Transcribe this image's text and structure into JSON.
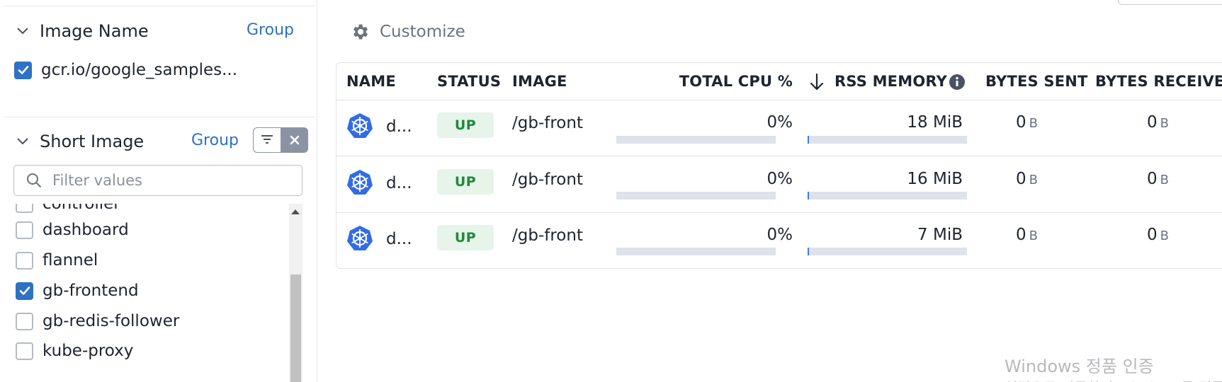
{
  "sidebar": {
    "facets": [
      {
        "title": "Image Name",
        "group_label": "Group",
        "selected": [
          {
            "label": "gcr.io/google_samples...",
            "checked": true
          }
        ]
      },
      {
        "title": "Short Image",
        "group_label": "Group",
        "search_placeholder": "Filter values",
        "values": [
          {
            "label": "controller",
            "checked": false
          },
          {
            "label": "dashboard",
            "checked": false
          },
          {
            "label": "flannel",
            "checked": false
          },
          {
            "label": "gb-frontend",
            "checked": true
          },
          {
            "label": "gb-redis-follower",
            "checked": false
          },
          {
            "label": "kube-proxy",
            "checked": false
          }
        ]
      }
    ]
  },
  "toolbar": {
    "customize_label": "Customize"
  },
  "table": {
    "columns": [
      "NAME",
      "STATUS",
      "IMAGE",
      "TOTAL CPU %",
      "RSS MEMORY",
      "BYTES SENT",
      "BYTES RECEIVE"
    ],
    "sort_column": "RSS MEMORY",
    "rows": [
      {
        "name": "d...",
        "status": "UP",
        "image": "/gb-front",
        "cpu": "0%",
        "cpu_fraction": 0.0,
        "memory": "18 MiB",
        "memory_fraction": 0.008,
        "sent_value": "0",
        "sent_unit": "B",
        "recv_value": "0",
        "recv_unit": "B"
      },
      {
        "name": "d...",
        "status": "UP",
        "image": "/gb-front",
        "cpu": "0%",
        "cpu_fraction": 0.0,
        "memory": "16 MiB",
        "memory_fraction": 0.007,
        "sent_value": "0",
        "sent_unit": "B",
        "recv_value": "0",
        "recv_unit": "B"
      },
      {
        "name": "d...",
        "status": "UP",
        "image": "/gb-front",
        "cpu": "0%",
        "cpu_fraction": 0.0,
        "memory": "7 MiB",
        "memory_fraction": 0.003,
        "sent_value": "0",
        "sent_unit": "B",
        "recv_value": "0",
        "recv_unit": "B"
      }
    ]
  },
  "watermark": {
    "line1": "Windows 정품 인증",
    "line2": "설정으로 이동하여 Windows를 정품"
  },
  "colors": {
    "accent": "#2d72c3",
    "status_up_bg": "#e6f4ea",
    "status_up_text": "#1f8a3b",
    "bar_fill": "#3f7fe0",
    "bar_track": "#dfe2ea"
  },
  "icons": {
    "gear": "gear-icon",
    "kubernetes": "kubernetes-icon",
    "search": "search-icon",
    "info": "info-icon",
    "sort": "sort-desc-arrow-icon"
  }
}
